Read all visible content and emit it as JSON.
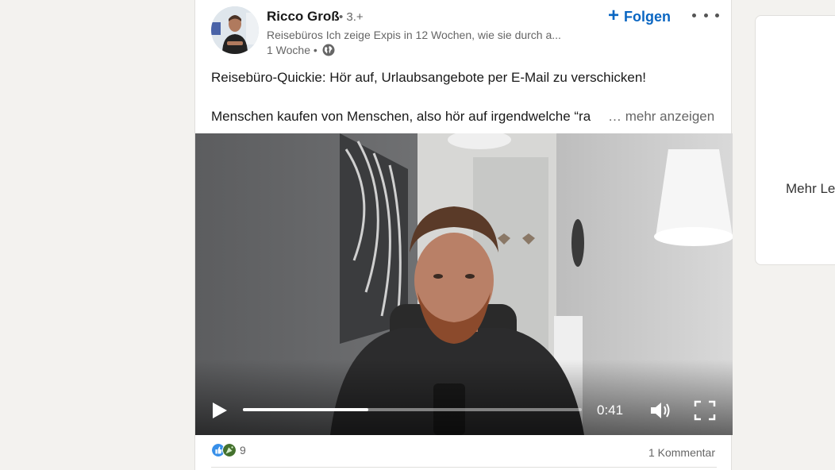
{
  "post": {
    "author": {
      "name": "Ricco Groß",
      "degree": "• 3.+",
      "tagline": "Reisebüros Ich zeige Expis in 12 Wochen, wie sie durch a...",
      "time": "1 Woche •"
    },
    "follow_label": "Folgen",
    "text_line1": "Reisebüro-Quickie: Hör auf, Urlaubsangebote per E-Mail zu verschicken!",
    "text_line2": "Menschen kaufen von Menschen, also hör auf irgendwelche “ra",
    "see_more": "… mehr anzeigen",
    "video": {
      "time": "0:41",
      "progress": 0.37
    },
    "reactions_count": "9",
    "comments_label": "1 Kommentar"
  },
  "sidebar": {
    "text": "Mehr Le"
  },
  "icons": {
    "reactions": [
      "like-icon",
      "celebrate-icon"
    ],
    "meta": "globe-icon",
    "controls": [
      "play-icon",
      "volume-icon",
      "fullscreen-icon"
    ]
  },
  "colors": {
    "accent": "#0a66c2",
    "background": "#f3f2ef"
  }
}
